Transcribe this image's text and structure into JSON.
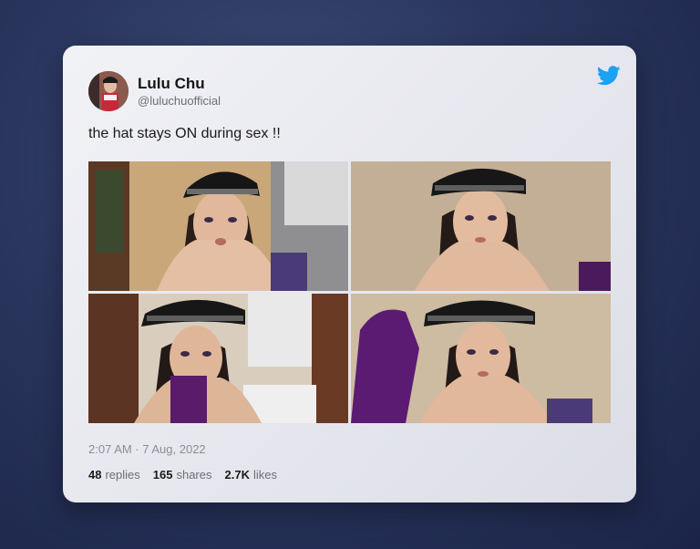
{
  "tweet": {
    "author_name": "Lulu Chu",
    "author_handle": "@luluchuofficial",
    "text": "the hat stays ON during sex !!",
    "timestamp": "2:07 AM · 7 Aug, 2022",
    "stats": {
      "replies_count": "48",
      "replies_label": "replies",
      "shares_count": "165",
      "shares_label": "shares",
      "likes_count": "2.7K",
      "likes_label": "likes"
    },
    "photos": [
      "photo-1",
      "photo-2",
      "photo-3",
      "photo-4"
    ]
  },
  "icons": {
    "brand": "twitter-bird-icon"
  },
  "colors": {
    "twitter_blue": "#1da1f2",
    "background_top": "#3e4f7c",
    "background_bottom": "#1b2448",
    "card": "#eceef3"
  }
}
